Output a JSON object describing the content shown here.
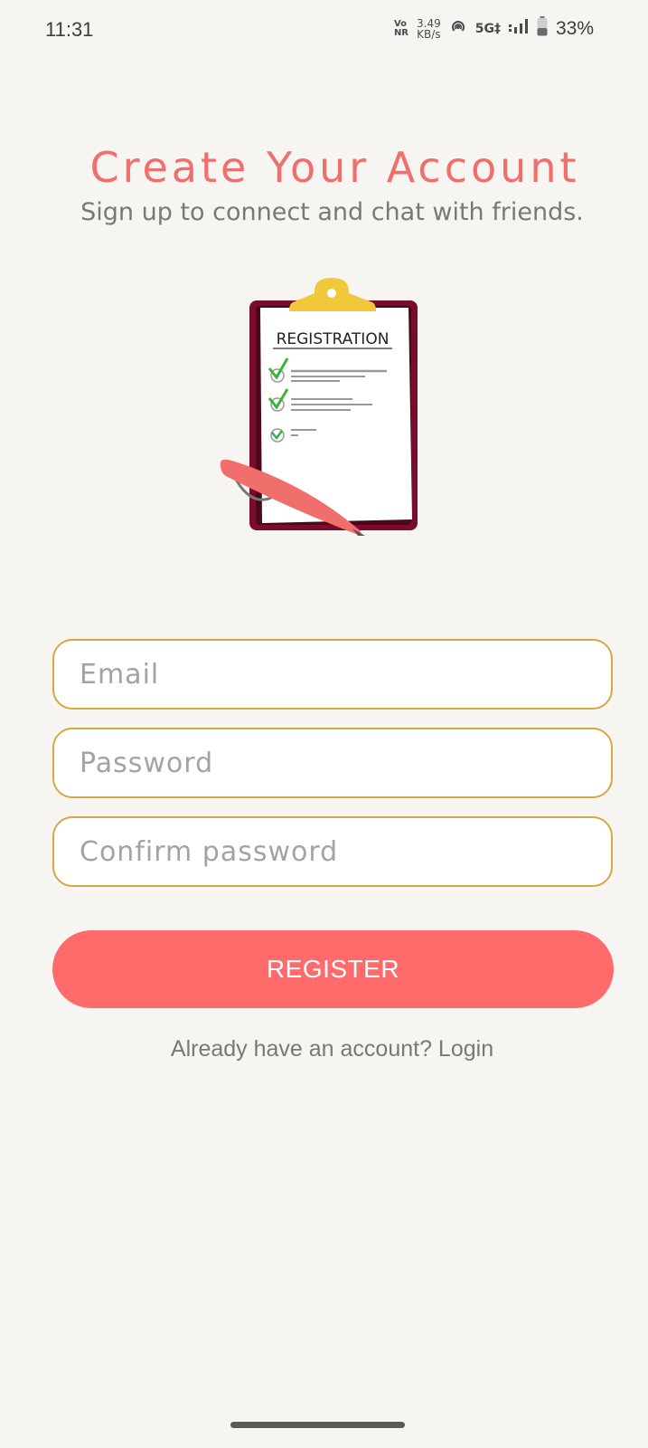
{
  "status_bar": {
    "time": "11:31",
    "volte_top": "Vo",
    "volte_bottom": "NR",
    "speed_value": "3.49",
    "speed_unit": "KB/s",
    "network": "5G‡",
    "battery_percent": "33%",
    "icons": [
      "hotspot-icon",
      "signal-icon",
      "battery-icon"
    ]
  },
  "header": {
    "title": "Create Your Account",
    "subtitle": "Sign up to connect and chat with friends."
  },
  "illustration": {
    "label": "REGISTRATION",
    "icon": "clipboard-registration-icon"
  },
  "form": {
    "email_placeholder": "Email",
    "password_placeholder": "Password",
    "confirm_placeholder": "Confirm password",
    "register_label": "REGISTER",
    "login_prompt": "Already have an account? Login"
  },
  "colors": {
    "background": "#f7f5f2",
    "accent": "#ff6b6b",
    "title": "#f06e6c",
    "field_border": "#d4a942",
    "clipboard_frame": "#7a0c2e",
    "clip": "#f0c83a",
    "check": "#3bb33b"
  }
}
